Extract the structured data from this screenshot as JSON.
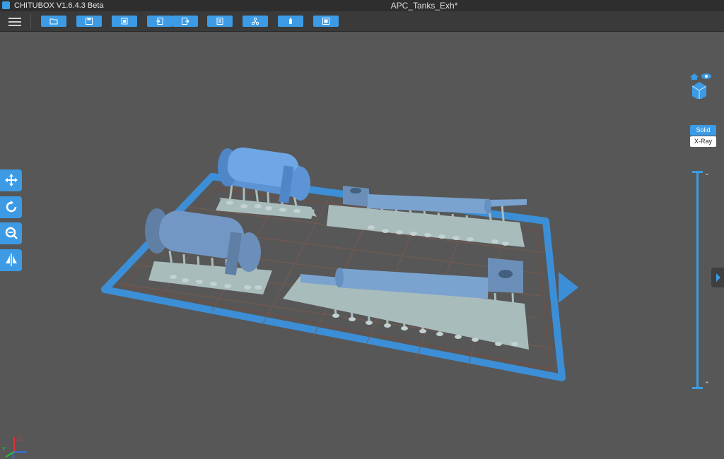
{
  "titlebar": {
    "app_name": "CHITUBOX V1.6.4.3 Beta",
    "document_title": "APC_Tanks_Exh*"
  },
  "toolbar": {
    "menu_icon": "hamburger-menu-icon",
    "buttons": [
      {
        "icon": "open-file-icon"
      },
      {
        "icon": "save-icon"
      },
      {
        "icon": "new-project-icon"
      },
      {
        "icon": "import-icon"
      },
      {
        "icon": "export-icon"
      },
      {
        "icon": "settings-icon"
      },
      {
        "icon": "network-icon"
      },
      {
        "icon": "supports-icon"
      },
      {
        "icon": "slice-icon"
      }
    ]
  },
  "left_tools": [
    {
      "icon": "move-icon"
    },
    {
      "icon": "rotate-icon"
    },
    {
      "icon": "scale-icon"
    },
    {
      "icon": "mirror-icon"
    }
  ],
  "view_modes": {
    "solid": "Solid",
    "xray": "X-Ray"
  },
  "colors": {
    "accent": "#3c9be4",
    "background": "#575757",
    "model": "#6f9fd6",
    "supports": "#a9bcbc"
  },
  "axes": {
    "x": "X",
    "y": "Y",
    "z": "Z"
  }
}
